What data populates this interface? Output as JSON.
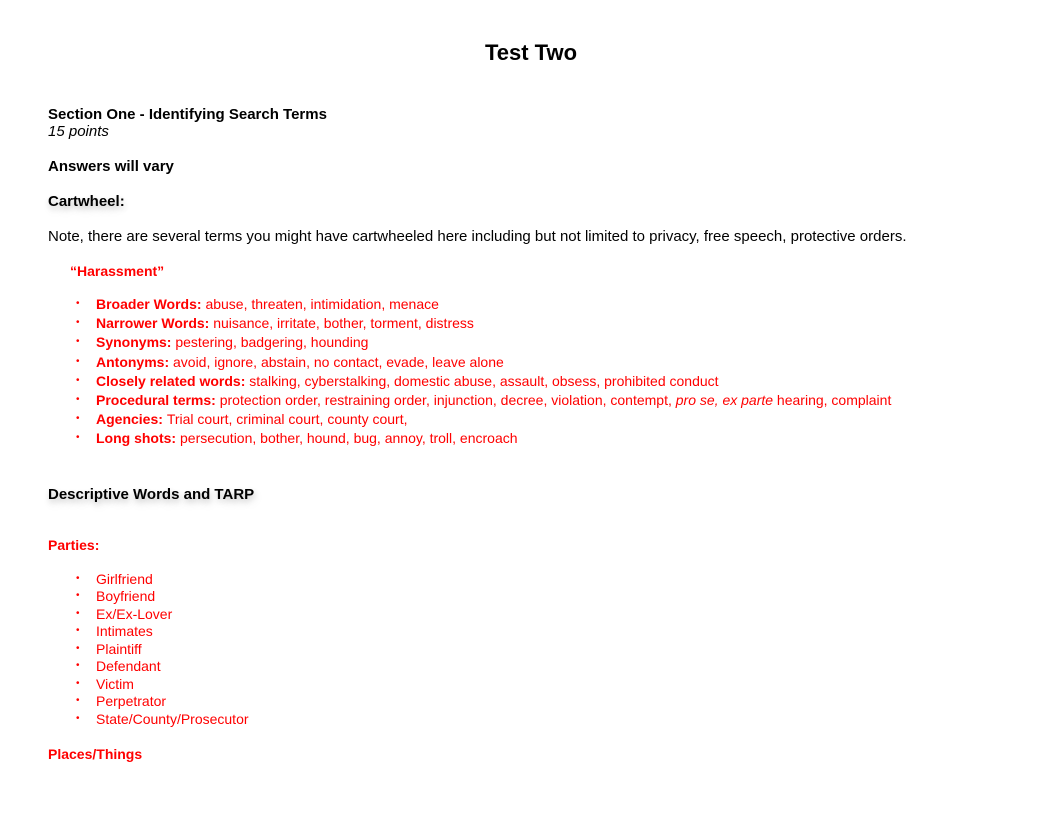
{
  "title": "Test Two",
  "section_heading": "Section One - Identifying Search Terms",
  "points": "15 points",
  "answers_vary": "Answers will vary",
  "cartwheel_heading": "Cartwheel:",
  "note": "Note, there are several terms you might have cartwheeled here including but not limited to privacy, free speech, protective orders.",
  "harassment_title": "“Harassment”",
  "cartwheel_items": {
    "broader": {
      "label": "Broader Words: ",
      "text": "abuse, threaten, intimidation, menace"
    },
    "narrower": {
      "label": "Narrower Words: ",
      "text": "nuisance, irritate, bother, torment, distress"
    },
    "synonyms": {
      "label": "Synonyms: ",
      "text": "pestering, badgering, hounding"
    },
    "antonyms": {
      "label": "Antonyms: ",
      "text": "avoid, ignore, abstain, no contact, evade, leave alone"
    },
    "closely": {
      "label": "Closely related words: ",
      "text": "stalking, cyberstalking, domestic abuse, assault, obsess, prohibited conduct"
    },
    "procedural": {
      "label": "Procedural terms: ",
      "text_before": "protection order, restraining order, injunction, decree, violation, contempt, ",
      "text_italic": "pro se, ex parte",
      "text_after": " hearing, complaint"
    },
    "agencies": {
      "label": "Agencies: ",
      "text": "Trial court, criminal court, county court,"
    },
    "longshots": {
      "label": "Long shots: ",
      "text": "persecution, bother, hound, bug, annoy, troll, encroach"
    }
  },
  "descriptive_heading": "Descriptive Words and TARP",
  "parties_title": "Parties:",
  "parties": [
    "Girlfriend",
    "Boyfriend",
    "Ex/Ex-Lover",
    "Intimates",
    "Plaintiff",
    "Defendant",
    "Victim",
    "Perpetrator",
    "State/County/Prosecutor"
  ],
  "places_title": "Places/Things"
}
